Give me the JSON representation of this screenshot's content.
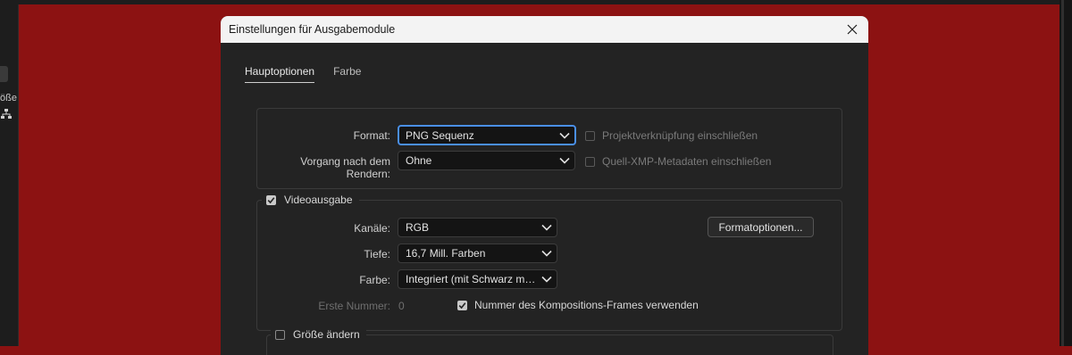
{
  "app": {
    "left_text": "öße"
  },
  "dialog": {
    "title": "Einstellungen für Ausgabemodule"
  },
  "tabs": [
    {
      "label": "Hauptoptionen",
      "active": true
    },
    {
      "label": "Farbe",
      "active": false
    }
  ],
  "main": {
    "format": {
      "label": "Format:",
      "value": "PNG Sequenz"
    },
    "post_render": {
      "label": "Vorgang nach dem Rendern:",
      "value": "Ohne"
    },
    "include_project_link": {
      "label": "Projektverknüpfung einschließen",
      "checked": false,
      "enabled": false
    },
    "include_xmp": {
      "label": "Quell-XMP-Metadaten einschließen",
      "checked": false,
      "enabled": false
    }
  },
  "video": {
    "section_label": "Videoausgabe",
    "checked": true,
    "channels": {
      "label": "Kanäle:",
      "value": "RGB"
    },
    "depth": {
      "label": "Tiefe:",
      "value": "16,7 Mill. Farben"
    },
    "color": {
      "label": "Farbe:",
      "value": "Integriert (mit Schwarz mask…"
    },
    "format_options_button": "Formatoptionen...",
    "start_number": {
      "label": "Erste Nummer:",
      "value": "0"
    },
    "use_comp_frame": {
      "label": "Nummer des Kompositions-Frames verwenden",
      "checked": true
    }
  },
  "resize": {
    "label": "Größe ändern",
    "checked": false
  },
  "colors": {
    "accent": "#4a8fe8",
    "background": "#8c1212",
    "dialog_bg": "#232323"
  }
}
